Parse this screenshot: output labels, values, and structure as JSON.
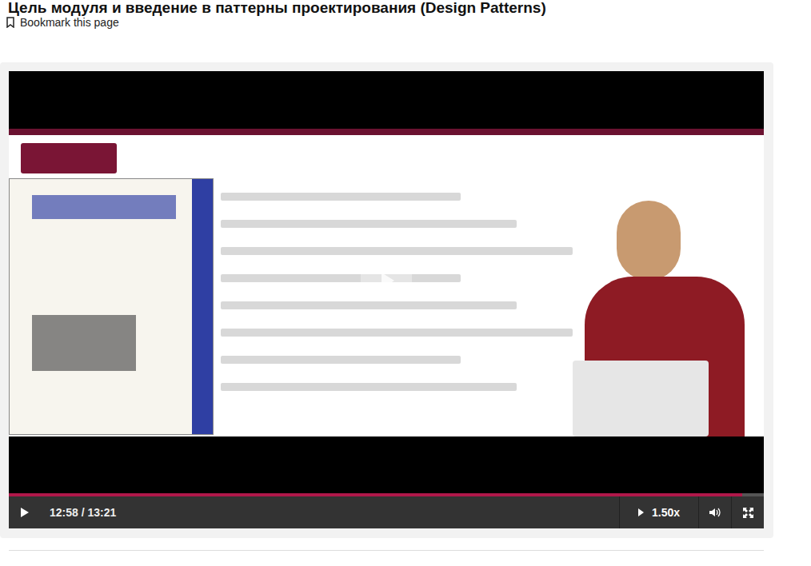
{
  "page": {
    "title": "Цель модуля и введение в паттерны проектирования (Design Patterns)",
    "bookmark": "Bookmark this page"
  },
  "player": {
    "paused": true,
    "time": "12:58 / 13:21",
    "level": 0.971,
    "speed": "1.50x"
  }
}
